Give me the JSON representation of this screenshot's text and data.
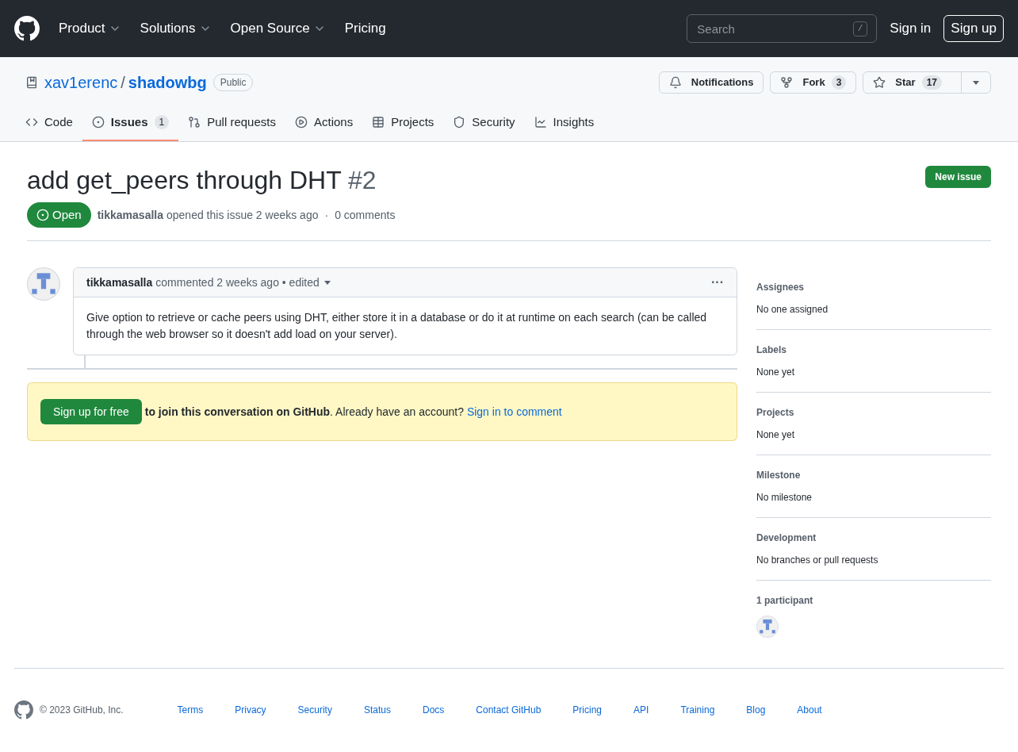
{
  "header": {
    "nav": [
      {
        "label": "Product",
        "dropdown": true
      },
      {
        "label": "Solutions",
        "dropdown": true
      },
      {
        "label": "Open Source",
        "dropdown": true
      },
      {
        "label": "Pricing",
        "dropdown": false
      }
    ],
    "search": {
      "placeholder": "Search",
      "shortcut": "/"
    },
    "sign_in": "Sign in",
    "sign_up": "Sign up"
  },
  "repo": {
    "owner": "xav1erenc",
    "separator": "/",
    "name": "shadowbg",
    "visibility": "Public",
    "actions": [
      {
        "kind": "notifications",
        "label": "Notifications"
      },
      {
        "kind": "fork",
        "label": "Fork",
        "count": "3"
      },
      {
        "kind": "star",
        "label": "Star",
        "count": "17"
      }
    ]
  },
  "tabs": [
    {
      "kind": "code",
      "label": "Code",
      "selected": false
    },
    {
      "kind": "issues",
      "label": "Issues",
      "count": "1",
      "selected": true
    },
    {
      "kind": "pulls",
      "label": "Pull requests",
      "selected": false
    },
    {
      "kind": "actions",
      "label": "Actions",
      "selected": false
    },
    {
      "kind": "projects",
      "label": "Projects",
      "selected": false
    },
    {
      "kind": "security",
      "label": "Security",
      "selected": false
    },
    {
      "kind": "insights",
      "label": "Insights",
      "selected": false
    }
  ],
  "issue": {
    "title": "add get_peers through DHT",
    "number": "#2",
    "state": "Open",
    "author": "tikkamasalla",
    "meta": "opened this issue 2 weeks ago",
    "separator": "·",
    "comments": "0 comments",
    "new_issue": "New issue"
  },
  "comment": {
    "author": "tikkamasalla",
    "meta": "commented 2 weeks ago • edited",
    "more": "···",
    "body": "Give option to retrieve or cache peers using DHT, either store it in a database or do it at runtime on each search (can be called through the web browser so it doesn't add load on your server)."
  },
  "signup_banner": {
    "button": "Sign up for free",
    "text": "**to join this conversation on GitHub**. Already have an account? ",
    "link": "Sign in to comment"
  },
  "sidebar": [
    {
      "heading": "Assignees",
      "value": "No one assigned"
    },
    {
      "heading": "Labels",
      "value": "None yet"
    },
    {
      "heading": "Projects",
      "value": "None yet"
    },
    {
      "heading": "Milestone",
      "value": "No milestone"
    },
    {
      "heading": "Development",
      "value": "No branches or pull requests"
    }
  ],
  "participants": {
    "heading": "1 participant"
  },
  "footer": {
    "copyright": "© 2023 GitHub, Inc.",
    "links": [
      "Terms",
      "Privacy",
      "Security",
      "Status",
      "Docs",
      "Contact GitHub",
      "Pricing",
      "API",
      "Training",
      "Blog",
      "About"
    ]
  }
}
